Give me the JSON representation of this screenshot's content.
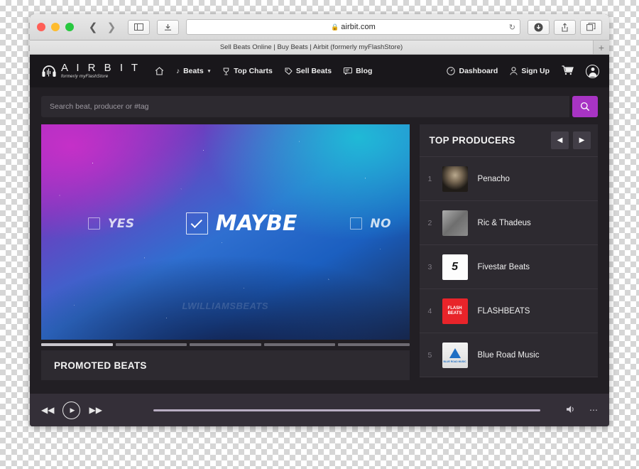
{
  "browser": {
    "url": "airbit.com",
    "lock_icon": "lock-icon",
    "reload_icon": "reload-icon",
    "back_icon": "back-arrow-icon",
    "forward_icon": "forward-arrow-icon",
    "sidebar_icon": "sidebar-toggle-icon",
    "reader_icon": "reader-view-icon",
    "downloads_icon": "downloads-icon",
    "share_icon": "share-icon",
    "tabs_icon": "show-tabs-icon",
    "new_tab_label": "+",
    "tab_title": "Sell Beats Online | Buy Beats | Airbit (formerly myFlashStore)"
  },
  "site": {
    "logo": {
      "icon": "headphones-icon",
      "name": "A I R B I T",
      "tagline": "formerly myFlashStore"
    },
    "nav": [
      {
        "label": "",
        "icon": "home-icon"
      },
      {
        "label": "Beats",
        "icon": "music-note-icon",
        "caret": "▾"
      },
      {
        "label": "Top Charts",
        "icon": "trophy-icon"
      },
      {
        "label": "Sell Beats",
        "icon": "tag-icon"
      },
      {
        "label": "Blog",
        "icon": "comment-icon"
      }
    ],
    "nav_right": [
      {
        "label": "Dashboard",
        "icon": "gauge-icon"
      },
      {
        "label": "Sign Up",
        "icon": "user-icon"
      }
    ],
    "cart_icon": "shopping-cart-icon",
    "account_icon": "account-avatar-icon"
  },
  "search": {
    "placeholder": "Search beat, producer or #tag",
    "value": "",
    "button_icon": "search-icon",
    "button_color": "#a834c4"
  },
  "hero": {
    "options": [
      {
        "label": "YES",
        "checked": false
      },
      {
        "label": "MAYBE",
        "checked": true
      },
      {
        "label": "NO",
        "checked": false
      }
    ],
    "watermark": "LWILLIAMSBEATS",
    "slides": 5,
    "active_slide": 1
  },
  "promoted": {
    "title": "PROMOTED BEATS"
  },
  "top_producers": {
    "title": "TOP PRODUCERS",
    "prev_icon": "chevron-left-icon",
    "next_icon": "chevron-right-icon",
    "items": [
      {
        "rank": "1",
        "name": "Penacho",
        "thumb": "penacho-avatar"
      },
      {
        "rank": "2",
        "name": "Ric & Thadeus",
        "thumb": "ric-thadeus-avatar"
      },
      {
        "rank": "3",
        "name": "Fivestar Beats",
        "thumb": "fivestar-logo",
        "thumb_text": "5"
      },
      {
        "rank": "4",
        "name": "FLASHBEATS",
        "thumb": "flashbeats-logo",
        "thumb_text": "FLASH BEATS"
      },
      {
        "rank": "5",
        "name": "Blue Road Music",
        "thumb": "blue-road-logo",
        "thumb_text": "BLUE ROAD MUSIC"
      }
    ]
  },
  "player": {
    "prev_icon": "rewind-icon",
    "play_icon": "play-icon",
    "next_icon": "fast-forward-icon",
    "volume_icon": "volume-icon",
    "more_icon": "more-options-icon",
    "progress_percent": 0
  }
}
